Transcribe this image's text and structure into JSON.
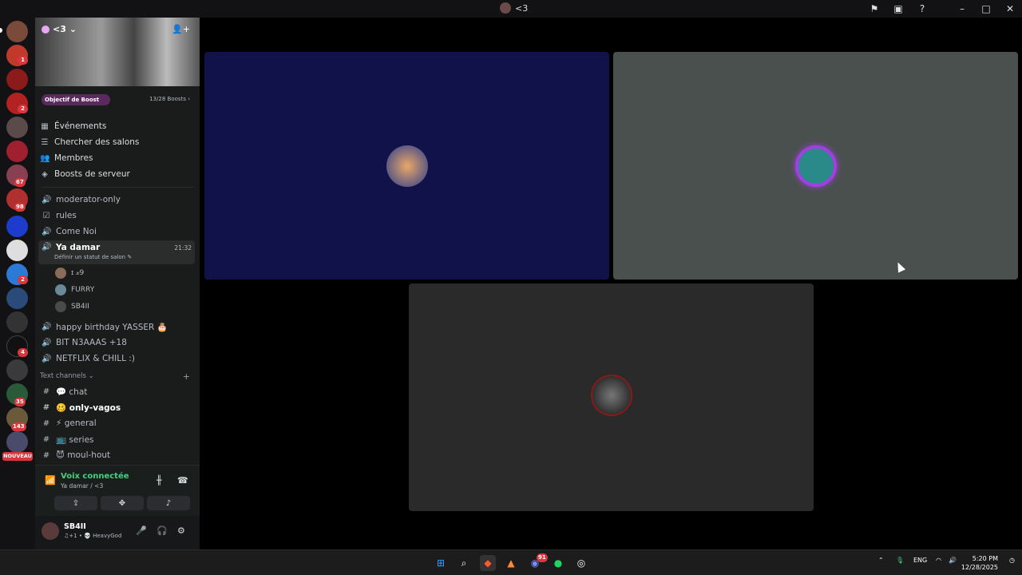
{
  "titlebar": {
    "title": "<3",
    "icons": [
      "inbox-flag-icon",
      "screen-icon",
      "help-icon",
      "minimize-icon",
      "maximize-icon",
      "close-icon"
    ]
  },
  "servers": {
    "badges": [
      {
        "label": "1"
      },
      {
        "label": "2"
      },
      {
        "label": "67"
      },
      {
        "label": "98"
      },
      {
        "label": "2"
      },
      {
        "label": "4"
      },
      {
        "label": "35"
      },
      {
        "label": "143"
      }
    ],
    "new_label": "NOUVEAU"
  },
  "guild": {
    "name": "<3",
    "boost_goal": "Objectif de Boost",
    "boost_count": "13/28 Boosts",
    "menu": [
      {
        "label": "Événements",
        "icon": "calendar-icon"
      },
      {
        "label": "Chercher des salons",
        "icon": "browse-icon"
      },
      {
        "label": "Membres",
        "icon": "members-icon"
      },
      {
        "label": "Boosts de serveur",
        "icon": "boost-icon"
      }
    ],
    "channels_top": [
      {
        "label": "moderator-only",
        "icon": "speaker-icon"
      },
      {
        "label": "rules",
        "icon": "rules-icon"
      },
      {
        "label": "Come Noi",
        "icon": "speaker-icon"
      }
    ],
    "active_voice": {
      "label": "Ya damar",
      "time": "21:32",
      "sub": "Définir un statut de salon ✎",
      "users": [
        "ɪ 𝓍𝟫",
        "FURRY",
        "SB4II"
      ]
    },
    "voice_more": [
      {
        "label": "happy birthday YASSER 🎂"
      },
      {
        "label": "BIT N3AAAS +18"
      },
      {
        "label": "NETFLIX & CHILL :)"
      }
    ],
    "text_category": "Text channels",
    "text_channels": [
      {
        "label": "💬 chat",
        "bold": false
      },
      {
        "label": "🥴 only-vagos",
        "bold": true
      },
      {
        "label": "⚡ general",
        "bold": false
      },
      {
        "label": "📺 series",
        "bold": false
      },
      {
        "label": "😈 moul-hout",
        "bold": false
      }
    ]
  },
  "voice_panel": {
    "status": "Voix connectée",
    "sub": "Ya damar / <3"
  },
  "user": {
    "name": "SB4II",
    "status": "♫+1 • 💀 HeavyGod"
  },
  "taskbar": {
    "lang": "ENG",
    "time": "5:20 PM",
    "date": "12/28/2025",
    "discord_badge": "91"
  }
}
